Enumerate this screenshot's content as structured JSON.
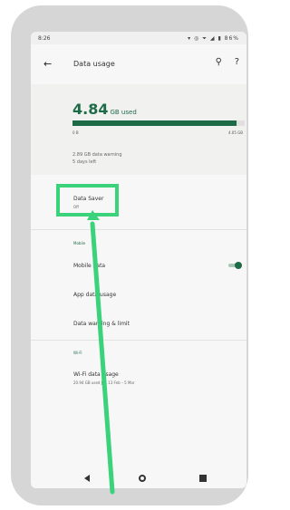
{
  "status_bar": {
    "time": "8:26",
    "icons": "▾ ◎ ⏷ ◢ ▮ 86%"
  },
  "app_bar": {
    "title": "Data usage",
    "back_icon": "back-arrow-icon",
    "search_icon": "search-icon",
    "help_icon": "help-icon"
  },
  "usage": {
    "amount": "4.84",
    "unit": "GB used",
    "bar_left": "0 B",
    "bar_right": "4.05 GB",
    "progress": 0.95,
    "remaining": "2.89 GB data warning",
    "cycle": "5 days left"
  },
  "data_saver": {
    "label": "Data Saver",
    "value": "Off"
  },
  "mobile_section": {
    "header": "Mobile",
    "mobile_data_label": "Mobile data",
    "mobile_data_enabled": true,
    "app_data_usage_label": "App data usage",
    "data_warning_label": "Data warning & limit"
  },
  "wifi_section": {
    "header": "Wi-Fi",
    "wifi_usage_label": "Wi-Fi data usage",
    "wifi_usage_sub": "20.94 GB used Jan 13 Feb – 5 Mar"
  },
  "nav": {
    "back": "nav-back-icon",
    "home": "nav-home-icon",
    "recent": "nav-recents-icon"
  },
  "colors": {
    "accent": "#1e6b48",
    "highlight": "#3ad27b"
  }
}
